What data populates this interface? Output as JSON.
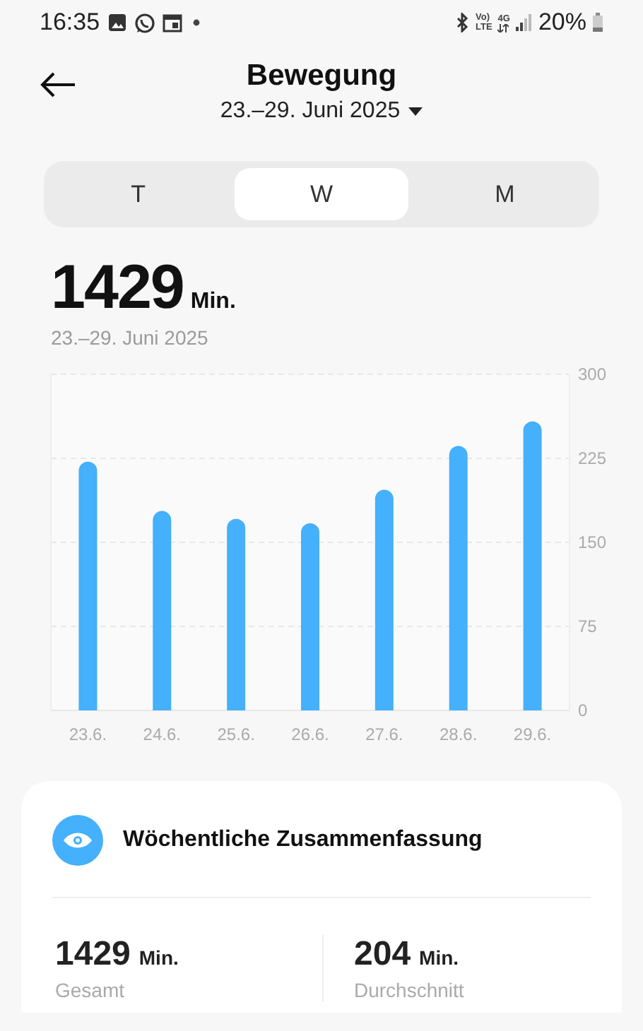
{
  "status_bar": {
    "time": "16:35",
    "indicators": [
      "Vo)",
      "LTE",
      "4G"
    ],
    "battery": "20%"
  },
  "header": {
    "title": "Bewegung",
    "period": "23.–29. Juni 2025"
  },
  "tabs": [
    {
      "label": "T",
      "selected": false
    },
    {
      "label": "W",
      "selected": true
    },
    {
      "label": "M",
      "selected": false
    }
  ],
  "total": {
    "value": "1429",
    "unit": "Min.",
    "period": "23.–29. Juni 2025"
  },
  "chart_data": {
    "type": "bar",
    "categories": [
      "23.6.",
      "24.6.",
      "25.6.",
      "26.6.",
      "27.6.",
      "28.6.",
      "29.6."
    ],
    "series": [
      {
        "color": "#45b0fb",
        "values": [
          222,
          178,
          171,
          167,
          197,
          236,
          258
        ]
      }
    ],
    "grid": true,
    "ylim": [
      0,
      300
    ],
    "yticks": [
      0,
      75,
      150,
      225,
      300
    ]
  },
  "summary": {
    "title": "Wöchentliche Zusammenfassung",
    "stats": [
      {
        "value": "1429",
        "unit": "Min.",
        "label": "Gesamt"
      },
      {
        "value": "204",
        "unit": "Min.",
        "label": "Durchschnitt"
      }
    ]
  }
}
